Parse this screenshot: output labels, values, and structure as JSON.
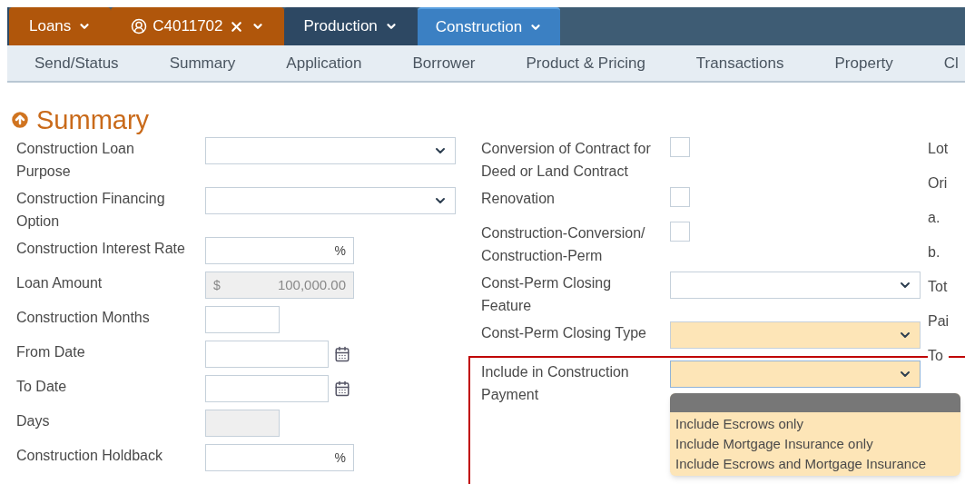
{
  "top_tabs": [
    {
      "label": "Loans",
      "kind": "menu",
      "color": "#b0560b",
      "selected": false,
      "closable": false
    },
    {
      "label": "C4011702",
      "kind": "record",
      "color": "#b0560b",
      "selected": false,
      "closable": true
    },
    {
      "label": "Production",
      "kind": "menu",
      "color": "#2d4863",
      "selected": false,
      "closable": false
    },
    {
      "label": "Construction",
      "kind": "menu",
      "color": "#3b80c3",
      "selected": true,
      "closable": false
    }
  ],
  "sub_nav": [
    "Send/Status",
    "Summary",
    "Application",
    "Borrower",
    "Product & Pricing",
    "Transactions",
    "Property",
    "Cl"
  ],
  "section_title": "Summary",
  "left_fields": [
    {
      "label": "Construction Loan Purpose",
      "kind": "select"
    },
    {
      "label": "Construction Financing Option",
      "kind": "select"
    },
    {
      "label": "Construction Interest Rate",
      "kind": "percent",
      "suffix": "%"
    },
    {
      "label": "Loan Amount",
      "kind": "currency",
      "prefix": "$",
      "value": "100,000.00",
      "disabled": true
    },
    {
      "label": "Construction Months",
      "kind": "short"
    },
    {
      "label": "From Date",
      "kind": "date"
    },
    {
      "label": "To Date",
      "kind": "date"
    },
    {
      "label": "Days",
      "kind": "short",
      "disabled": true
    },
    {
      "label": "Construction Holdback",
      "kind": "percent",
      "suffix": "%"
    }
  ],
  "middle_fields": [
    {
      "label": "Conversion of Contract for Deed or Land Contract",
      "kind": "checkbox",
      "checked": false
    },
    {
      "label": "Renovation",
      "kind": "checkbox",
      "checked": false
    },
    {
      "label": "Construction-Conversion/ Construction-Perm",
      "kind": "checkbox",
      "checked": false
    },
    {
      "label": "Const-Perm Closing Feature",
      "kind": "select",
      "required": false
    },
    {
      "label": "Const-Perm Closing Type",
      "kind": "select",
      "required": true
    },
    {
      "label": "Include in Construction Payment",
      "kind": "select",
      "required": true,
      "open": true,
      "options": [
        "Include Escrows only",
        "Include Mortgage Insurance only",
        "Include Escrows and Mortgage Insurance"
      ]
    }
  ],
  "right_labels": [
    "Lot",
    "Ori",
    "a.",
    "b.",
    "Tot",
    "Pai",
    "To"
  ]
}
